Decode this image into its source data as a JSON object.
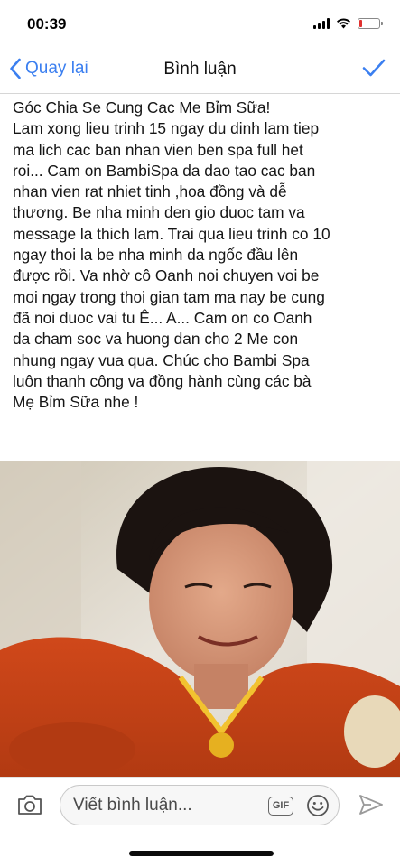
{
  "status_bar": {
    "time": "00:39",
    "battery_level": 0.15,
    "battery_color": "#e0312f"
  },
  "nav": {
    "back_label": "Quay lại",
    "title": "Bình luận",
    "accent_color": "#3b7ff0"
  },
  "post": {
    "lines": [
      "Góc Chia Se Cung Cac Me Bỉm Sữa!",
      "Lam xong lieu trinh 15 ngay du dinh lam tiep",
      "ma lich cac ban nhan vien ben spa full het",
      "roi... Cam on BambiSpa da dao tao cac ban",
      "nhan vien rat nhiet tinh ,hoa đồng và dễ",
      "thương.  Be nha minh den gio duoc tam va",
      "message la thich lam. Trai qua lieu trinh co 10",
      "ngay thoi la be nha minh da ngốc đầu lên",
      "được rồi. Va nhờ cô Oanh noi chuyen voi be",
      "moi ngay trong thoi gian tam ma nay be cung",
      "đã  noi duoc vai tu Ê... A... Cam on co Oanh",
      "da cham soc va huong dan cho 2 Me con",
      "nhung ngay vua qua. Chúc cho Bambi Spa",
      "luôn thanh công va đồng hành cùng các bà",
      "Mẹ Bỉm Sữa nhe !"
    ]
  },
  "composer": {
    "placeholder": "Viết bình luận...",
    "gif_label": "GIF"
  },
  "icons": {
    "back": "chevron-left-icon",
    "confirm": "checkmark-icon",
    "camera": "camera-icon",
    "emoji": "smiley-icon",
    "send": "send-icon"
  }
}
